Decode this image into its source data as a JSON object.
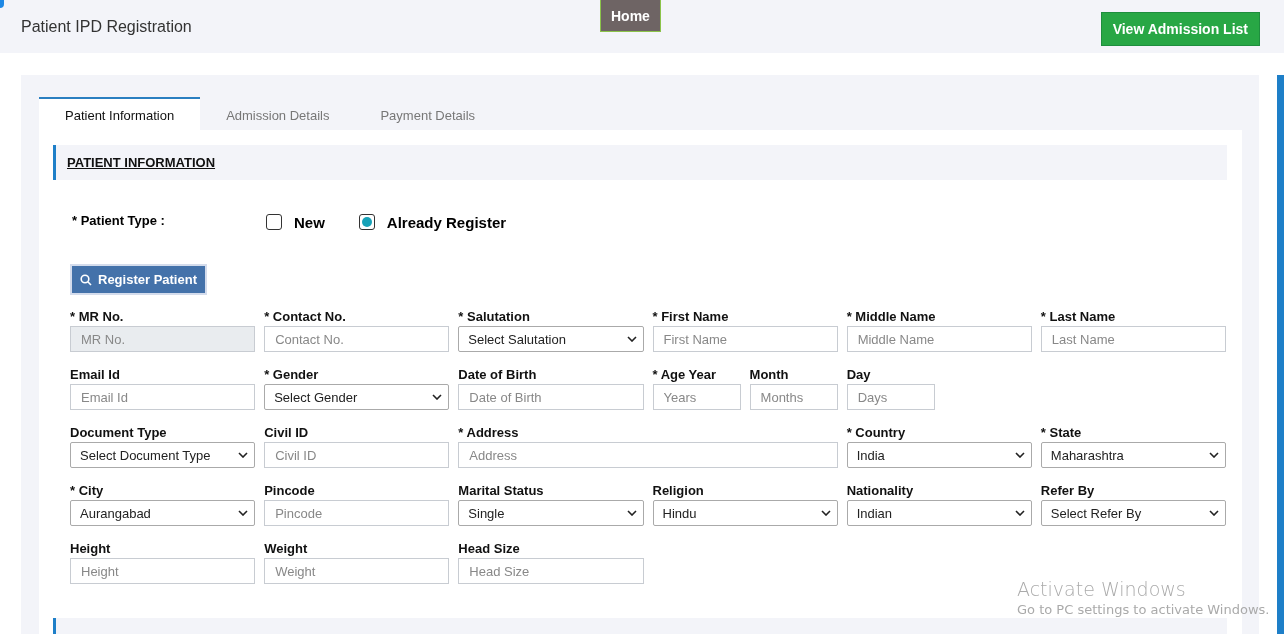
{
  "header": {
    "title": "Patient IPD Registration",
    "home_button": "Home",
    "action_button": "View Admission List"
  },
  "tabs": [
    {
      "label": "Patient Information",
      "selected": true
    },
    {
      "label": "Admission Details",
      "selected": false
    },
    {
      "label": "Payment Details",
      "selected": false
    }
  ],
  "section": {
    "title": "PATIENT INFORMATION"
  },
  "patient_type": {
    "label": "* Patient Type :",
    "options": [
      {
        "label": "New",
        "selected": false
      },
      {
        "label": "Already Register",
        "selected": true
      }
    ]
  },
  "register_button": "Register Patient",
  "field_rows": [
    [
      {
        "label": "* MR No.",
        "kind": "input",
        "placeholder": "MR No.",
        "disabled": true
      },
      {
        "label": "* Contact No.",
        "kind": "input",
        "placeholder": "Contact No."
      },
      {
        "label": "* Salutation",
        "kind": "select",
        "value": "Select Salutation"
      },
      {
        "label": "* First Name",
        "kind": "input",
        "placeholder": "First Name"
      },
      {
        "label": "* Middle Name",
        "kind": "input",
        "placeholder": "Middle Name"
      },
      {
        "label": "* Last Name",
        "kind": "input",
        "placeholder": "Last Name"
      }
    ],
    [
      {
        "label": "Email Id",
        "kind": "input",
        "placeholder": "Email Id"
      },
      {
        "label": "* Gender",
        "kind": "select",
        "value": "Select Gender"
      },
      {
        "label": "Date of Birth",
        "kind": "input",
        "placeholder": "Date of Birth"
      },
      {
        "label": "* Age Year",
        "kind": "narrow-input",
        "placeholder": "Years"
      },
      {
        "label": "Month",
        "kind": "narrow-input",
        "placeholder": "Months"
      },
      {
        "label": "Day",
        "kind": "narrow-input",
        "placeholder": "Days"
      }
    ],
    [
      {
        "label": "Document Type",
        "kind": "select",
        "value": "Select Document Type"
      },
      {
        "label": "Civil ID",
        "kind": "input",
        "placeholder": "Civil ID"
      },
      {
        "label": "* Address",
        "kind": "wide-input",
        "placeholder": "Address"
      },
      {
        "label": "* Country",
        "kind": "select",
        "value": "India"
      },
      {
        "label": "* State",
        "kind": "select",
        "value": "Maharashtra"
      }
    ],
    [
      {
        "label": "* City",
        "kind": "select",
        "value": "Aurangabad"
      },
      {
        "label": "Pincode",
        "kind": "input",
        "placeholder": "Pincode"
      },
      {
        "label": "Marital Status",
        "kind": "select",
        "value": "Single"
      },
      {
        "label": "Religion",
        "kind": "select",
        "value": "Hindu"
      },
      {
        "label": "Nationality",
        "kind": "select",
        "value": "Indian"
      },
      {
        "label": "Refer By",
        "kind": "select",
        "value": "Select Refer By"
      }
    ],
    [
      {
        "label": "Height",
        "kind": "input",
        "placeholder": "Height"
      },
      {
        "label": "Weight",
        "kind": "input",
        "placeholder": "Weight"
      },
      {
        "label": "Head Size",
        "kind": "input",
        "placeholder": "Head Size"
      }
    ]
  ],
  "os_notice": {
    "title": "Activate Windows",
    "text": "Go to PC settings to activate Windows."
  }
}
